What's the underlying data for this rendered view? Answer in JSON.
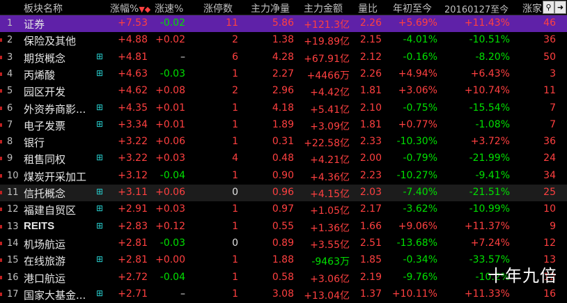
{
  "header": {
    "name": "板块名称",
    "chg": "涨幅%",
    "spd": "涨速%",
    "lim": "涨停数",
    "net": "主力净量",
    "amt": "主力金额",
    "vr": "量比",
    "ytd": "年初至今",
    "since": "20160127至今",
    "up": "涨家"
  },
  "icons": {
    "search": "search-icon",
    "arrow": "arrow-right-icon"
  },
  "rows": [
    {
      "num": "1",
      "name": "证券",
      "plus": false,
      "chg": "+7.53",
      "spd": "-0.02",
      "lim": "11",
      "net": "5.86",
      "amt": "+121.3亿",
      "vr": "2.26",
      "ytd": "+5.69%",
      "since": "+11.43%",
      "up": "46"
    },
    {
      "num": "2",
      "name": "保险及其他",
      "plus": false,
      "chg": "+4.88",
      "spd": "+0.02",
      "lim": "2",
      "net": "1.38",
      "amt": "+19.89亿",
      "vr": "2.15",
      "ytd": "-4.01%",
      "since": "-10.51%",
      "up": "36"
    },
    {
      "num": "3",
      "name": "期货概念",
      "plus": true,
      "chg": "+4.81",
      "spd": "–",
      "lim": "6",
      "net": "4.28",
      "amt": "+67.91亿",
      "vr": "2.12",
      "ytd": "-0.16%",
      "since": "-8.20%",
      "up": "50"
    },
    {
      "num": "4",
      "name": "丙烯酸",
      "plus": true,
      "chg": "+4.63",
      "spd": "-0.03",
      "lim": "1",
      "net": "2.27",
      "amt": "+4466万",
      "vr": "2.26",
      "ytd": "+4.94%",
      "since": "+6.43%",
      "up": "3"
    },
    {
      "num": "5",
      "name": "园区开发",
      "plus": false,
      "chg": "+4.62",
      "spd": "+0.08",
      "lim": "2",
      "net": "2.96",
      "amt": "+4.42亿",
      "vr": "1.81",
      "ytd": "+3.06%",
      "since": "+10.74%",
      "up": "11"
    },
    {
      "num": "6",
      "name": "外资券商影...",
      "plus": true,
      "chg": "+4.35",
      "spd": "+0.01",
      "lim": "1",
      "net": "4.18",
      "amt": "+5.41亿",
      "vr": "2.10",
      "ytd": "-0.75%",
      "since": "-15.54%",
      "up": "7"
    },
    {
      "num": "7",
      "name": "电子发票",
      "plus": true,
      "chg": "+3.34",
      "spd": "+0.01",
      "lim": "1",
      "net": "1.89",
      "amt": "+3.09亿",
      "vr": "1.81",
      "ytd": "+0.77%",
      "since": "-1.08%",
      "up": "7"
    },
    {
      "num": "8",
      "name": "银行",
      "plus": false,
      "chg": "+3.22",
      "spd": "+0.06",
      "lim": "1",
      "net": "0.31",
      "amt": "+22.58亿",
      "vr": "2.33",
      "ytd": "-10.30%",
      "since": "+3.72%",
      "up": "36"
    },
    {
      "num": "9",
      "name": "租售同权",
      "plus": true,
      "chg": "+3.22",
      "spd": "+0.03",
      "lim": "4",
      "net": "0.48",
      "amt": "+4.21亿",
      "vr": "2.00",
      "ytd": "-0.79%",
      "since": "-21.99%",
      "up": "24"
    },
    {
      "num": "10",
      "name": "煤炭开采加工",
      "plus": false,
      "chg": "+3.12",
      "spd": "-0.04",
      "lim": "1",
      "net": "0.90",
      "amt": "+4.36亿",
      "vr": "2.23",
      "ytd": "-10.27%",
      "since": "-9.41%",
      "up": "34"
    },
    {
      "num": "11",
      "name": "信托概念",
      "plus": true,
      "chg": "+3.11",
      "spd": "+0.06",
      "lim": "0",
      "net": "0.96",
      "amt": "+4.15亿",
      "vr": "2.03",
      "ytd": "-7.40%",
      "since": "-21.51%",
      "up": "25"
    },
    {
      "num": "12",
      "name": "福建自贸区",
      "plus": true,
      "chg": "+2.91",
      "spd": "+0.03",
      "lim": "1",
      "net": "0.97",
      "amt": "+1.05亿",
      "vr": "2.17",
      "ytd": "-3.62%",
      "since": "-10.99%",
      "up": "10"
    },
    {
      "num": "13",
      "name": "REITS",
      "plus": true,
      "chg": "+2.83",
      "spd": "+0.12",
      "lim": "1",
      "net": "0.55",
      "amt": "+1.36亿",
      "vr": "1.66",
      "ytd": "+9.06%",
      "since": "+11.37%",
      "up": "9"
    },
    {
      "num": "14",
      "name": "机场航运",
      "plus": false,
      "chg": "+2.81",
      "spd": "-0.03",
      "lim": "0",
      "net": "0.89",
      "amt": "+3.55亿",
      "vr": "2.51",
      "ytd": "-13.68%",
      "since": "+7.24%",
      "up": "12"
    },
    {
      "num": "15",
      "name": "在线旅游",
      "plus": true,
      "chg": "+2.81",
      "spd": "+0.00",
      "lim": "1",
      "net": "1.88",
      "amt": "-9463万",
      "vr": "1.85",
      "ytd": "-0.34%",
      "since": "-33.57%",
      "up": "13"
    },
    {
      "num": "16",
      "name": "港口航运",
      "plus": false,
      "chg": "+2.72",
      "spd": "-0.04",
      "lim": "1",
      "net": "0.58",
      "amt": "+3.06亿",
      "vr": "2.19",
      "ytd": "-9.76%",
      "since": "-10.2%",
      "up": "12"
    },
    {
      "num": "17",
      "name": "国家大基金...",
      "plus": true,
      "chg": "+2.71",
      "spd": "–",
      "lim": "1",
      "net": "3.08",
      "amt": "+13.04亿",
      "vr": "1.37",
      "ytd": "+10.11%",
      "since": "+11.33%",
      "up": "16"
    }
  ],
  "watermark": "十年九倍",
  "colors": {
    "selected_row": "#5f21a8",
    "up": "#ff4040",
    "down": "#00e000",
    "plus_icon": "#28d0d0"
  }
}
